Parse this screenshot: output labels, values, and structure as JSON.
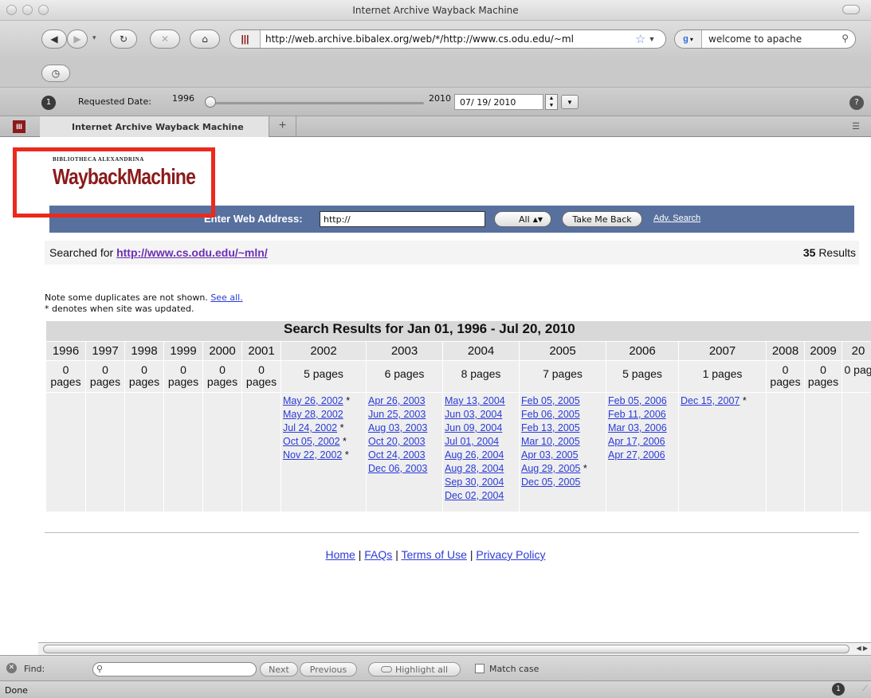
{
  "window": {
    "title": "Internet Archive Wayback Machine"
  },
  "toolbar": {
    "url": "http://web.archive.bibalex.org/web/*/http://www.cs.odu.edu/~ml",
    "search_text": "welcome to apache"
  },
  "date_bar": {
    "requested_label": "Requested Date:",
    "start_year": "1996",
    "end_year": "2010",
    "date_value": "07/ 19/ 2010",
    "slider_position": 0
  },
  "tab": {
    "label": "Internet Archive Wayback Machine",
    "new_tab": "+"
  },
  "logo": {
    "small": "BIBLIOTHECA ALEXANDRINA",
    "big": "WaybackMachine"
  },
  "search_band": {
    "label": "Enter Web Address:",
    "input_value": "http://",
    "select_value": "All",
    "button": "Take Me Back",
    "adv_link": "Adv. Search"
  },
  "searched": {
    "prefix": "Searched for",
    "url": "http://www.cs.odu.edu/~mln/",
    "count": "35",
    "results_word": "Results"
  },
  "note": {
    "line1": "Note some duplicates are not shown.",
    "see_all": "See all.",
    "line2": "* denotes when site was updated."
  },
  "results": {
    "title": "Search Results for Jan 01, 1996 - Jul 20, 2010",
    "years": [
      "1996",
      "1997",
      "1998",
      "1999",
      "2000",
      "2001",
      "2002",
      "2003",
      "2004",
      "2005",
      "2006",
      "2007",
      "2008",
      "2009",
      "20"
    ],
    "counts": [
      "0 pages",
      "0 pages",
      "0 pages",
      "0 pages",
      "0 pages",
      "0 pages",
      "5 pages",
      "6 pages",
      "8 pages",
      "7 pages",
      "5 pages",
      "1 pages",
      "0 pages",
      "0 pages",
      "0 pag"
    ],
    "links": {
      "2002": [
        "May 26, 2002 *",
        "May 28, 2002",
        "Jul 24, 2002 *",
        "Oct 05, 2002 *",
        "Nov 22, 2002 *"
      ],
      "2003": [
        "Apr 26, 2003",
        "Jun 25, 2003",
        "Aug 03, 2003",
        "Oct 20, 2003",
        "Oct 24, 2003",
        "Dec 06, 2003"
      ],
      "2004": [
        "May 13, 2004",
        "Jun 03, 2004",
        "Jun 09, 2004",
        "Jul 01, 2004",
        "Aug 26, 2004",
        "Aug 28, 2004",
        "Sep 30, 2004",
        "Dec 02, 2004"
      ],
      "2005": [
        "Feb 05, 2005",
        "Feb 06, 2005",
        "Feb 13, 2005",
        "Mar 10, 2005",
        "Apr 03, 2005",
        "Aug 29, 2005 *",
        "Dec 05, 2005"
      ],
      "2006": [
        "Feb 05, 2006",
        "Feb 11, 2006",
        "Mar 03, 2006",
        "Apr 17, 2006",
        "Apr 27, 2006"
      ],
      "2007": [
        "Dec 15, 2007 *"
      ]
    }
  },
  "footer": {
    "home": "Home",
    "faqs": "FAQs",
    "terms": "Terms of Use",
    "privacy": "Privacy Policy",
    "sep": "|"
  },
  "findbar": {
    "label": "Find:",
    "next": "Next",
    "previous": "Previous",
    "highlight": "Highlight all",
    "match_case": "Match case"
  },
  "status": {
    "text": "Done"
  },
  "colors": {
    "accent_band": "#58709e",
    "logo_red": "#8b1a1a",
    "annotation_box": "#ea2a1d",
    "link": "#2a3bd7",
    "visited": "#6b2fb3"
  }
}
